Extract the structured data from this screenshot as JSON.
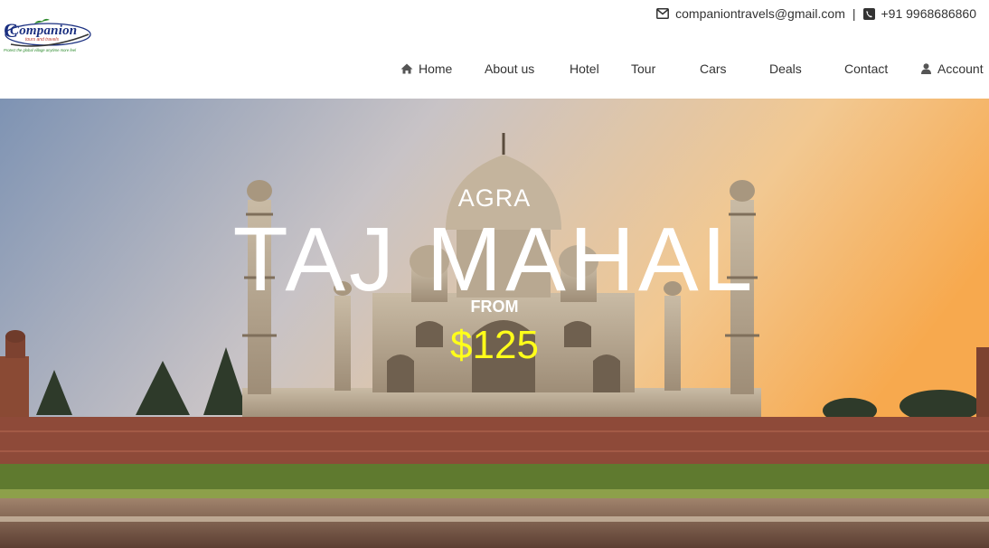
{
  "brand": {
    "name": "Companion",
    "subname": "tours and travels",
    "tagline": "Protect the global village anytime more feel"
  },
  "contact": {
    "email": "companiontravels@gmail.com",
    "separator": "|",
    "phone": "+91  9968686860"
  },
  "nav": {
    "items": [
      "Home",
      "About us",
      "Hotel",
      "Tour",
      "Cars",
      "Deals",
      "Contact",
      "Account"
    ]
  },
  "hero": {
    "city": "AGRA",
    "title": "TAJ MAHAL",
    "from_label": "FROM",
    "price": "$125",
    "price_color": "#ffff1a"
  },
  "colors": {
    "brand": "#1a2f80",
    "text": "#333333"
  },
  "icons": {
    "email": "envelope-icon",
    "phone": "phone-icon",
    "home": "home-icon",
    "account": "user-icon"
  }
}
